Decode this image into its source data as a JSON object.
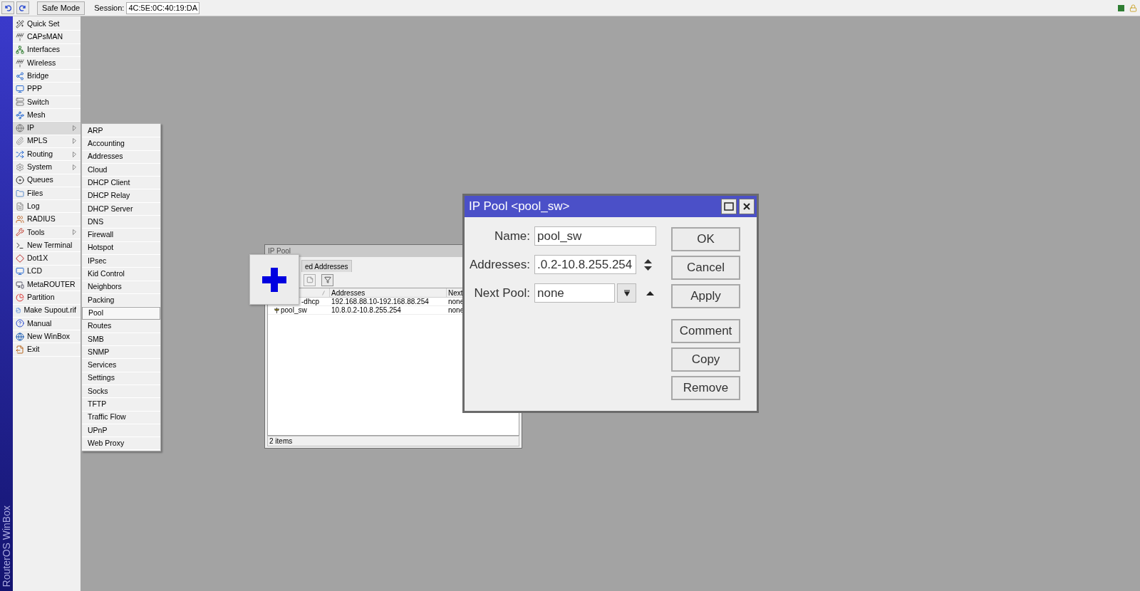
{
  "toolbar": {
    "safe_mode": "Safe Mode",
    "session_label": "Session:",
    "session": "4C:5E:0C:40:19:DA"
  },
  "sidebar": {
    "brand": "RouterOS WinBox",
    "items": [
      {
        "label": "Quick Set",
        "submenu": false,
        "selected": false
      },
      {
        "label": "CAPsMAN",
        "submenu": false,
        "selected": false
      },
      {
        "label": "Interfaces",
        "submenu": false,
        "selected": false
      },
      {
        "label": "Wireless",
        "submenu": false,
        "selected": false
      },
      {
        "label": "Bridge",
        "submenu": false,
        "selected": false
      },
      {
        "label": "PPP",
        "submenu": false,
        "selected": false
      },
      {
        "label": "Switch",
        "submenu": false,
        "selected": false
      },
      {
        "label": "Mesh",
        "submenu": false,
        "selected": false
      },
      {
        "label": "IP",
        "submenu": true,
        "selected": true
      },
      {
        "label": "MPLS",
        "submenu": true,
        "selected": false
      },
      {
        "label": "Routing",
        "submenu": true,
        "selected": false
      },
      {
        "label": "System",
        "submenu": true,
        "selected": false
      },
      {
        "label": "Queues",
        "submenu": false,
        "selected": false
      },
      {
        "label": "Files",
        "submenu": false,
        "selected": false
      },
      {
        "label": "Log",
        "submenu": false,
        "selected": false
      },
      {
        "label": "RADIUS",
        "submenu": false,
        "selected": false
      },
      {
        "label": "Tools",
        "submenu": true,
        "selected": false
      },
      {
        "label": "New Terminal",
        "submenu": false,
        "selected": false
      },
      {
        "label": "Dot1X",
        "submenu": false,
        "selected": false
      },
      {
        "label": "LCD",
        "submenu": false,
        "selected": false
      },
      {
        "label": "MetaROUTER",
        "submenu": false,
        "selected": false
      },
      {
        "label": "Partition",
        "submenu": false,
        "selected": false
      },
      {
        "label": "Make Supout.rif",
        "submenu": false,
        "selected": false
      },
      {
        "label": "Manual",
        "submenu": false,
        "selected": false
      },
      {
        "label": "New WinBox",
        "submenu": false,
        "selected": false
      },
      {
        "label": "Exit",
        "submenu": false,
        "selected": false
      }
    ]
  },
  "submenu": {
    "items": [
      {
        "label": "ARP",
        "selected": false
      },
      {
        "label": "Accounting",
        "selected": false
      },
      {
        "label": "Addresses",
        "selected": false
      },
      {
        "label": "Cloud",
        "selected": false
      },
      {
        "label": "DHCP Client",
        "selected": false
      },
      {
        "label": "DHCP Relay",
        "selected": false
      },
      {
        "label": "DHCP Server",
        "selected": false
      },
      {
        "label": "DNS",
        "selected": false
      },
      {
        "label": "Firewall",
        "selected": false
      },
      {
        "label": "Hotspot",
        "selected": false
      },
      {
        "label": "IPsec",
        "selected": false
      },
      {
        "label": "Kid Control",
        "selected": false
      },
      {
        "label": "Neighbors",
        "selected": false
      },
      {
        "label": "Packing",
        "selected": false
      },
      {
        "label": "Pool",
        "selected": true
      },
      {
        "label": "Routes",
        "selected": false
      },
      {
        "label": "SMB",
        "selected": false
      },
      {
        "label": "SNMP",
        "selected": false
      },
      {
        "label": "Services",
        "selected": false
      },
      {
        "label": "Settings",
        "selected": false
      },
      {
        "label": "Socks",
        "selected": false
      },
      {
        "label": "TFTP",
        "selected": false
      },
      {
        "label": "Traffic Flow",
        "selected": false
      },
      {
        "label": "UPnP",
        "selected": false
      },
      {
        "label": "Web Proxy",
        "selected": false
      }
    ]
  },
  "pool_window": {
    "title": "IP Pool",
    "tabs": [
      {
        "label": "ed Addresses",
        "selected": false
      }
    ],
    "columns": [
      "Addresses",
      "Next"
    ],
    "rows": [
      {
        "name": "-dhcp",
        "addresses": "192.168.88.10-192.168.88.254",
        "next": "none",
        "covered": true
      },
      {
        "name": "pool_sw",
        "addresses": "10.8.0.2-10.8.255.254",
        "next": "none",
        "covered": false
      }
    ],
    "status": "2 items"
  },
  "dialog": {
    "title": "IP Pool <pool_sw>",
    "fields": [
      {
        "kind": "text",
        "label": "Name:",
        "value": "pool_sw"
      },
      {
        "kind": "spinner",
        "label": "Addresses:",
        "value": ".0.2-10.8.255.254"
      },
      {
        "kind": "dropdown",
        "label": "Next Pool:",
        "value": "none"
      }
    ],
    "button_groups": [
      [
        "OK",
        "Cancel",
        "Apply"
      ],
      [
        "Comment",
        "Copy",
        "Remove"
      ]
    ]
  }
}
